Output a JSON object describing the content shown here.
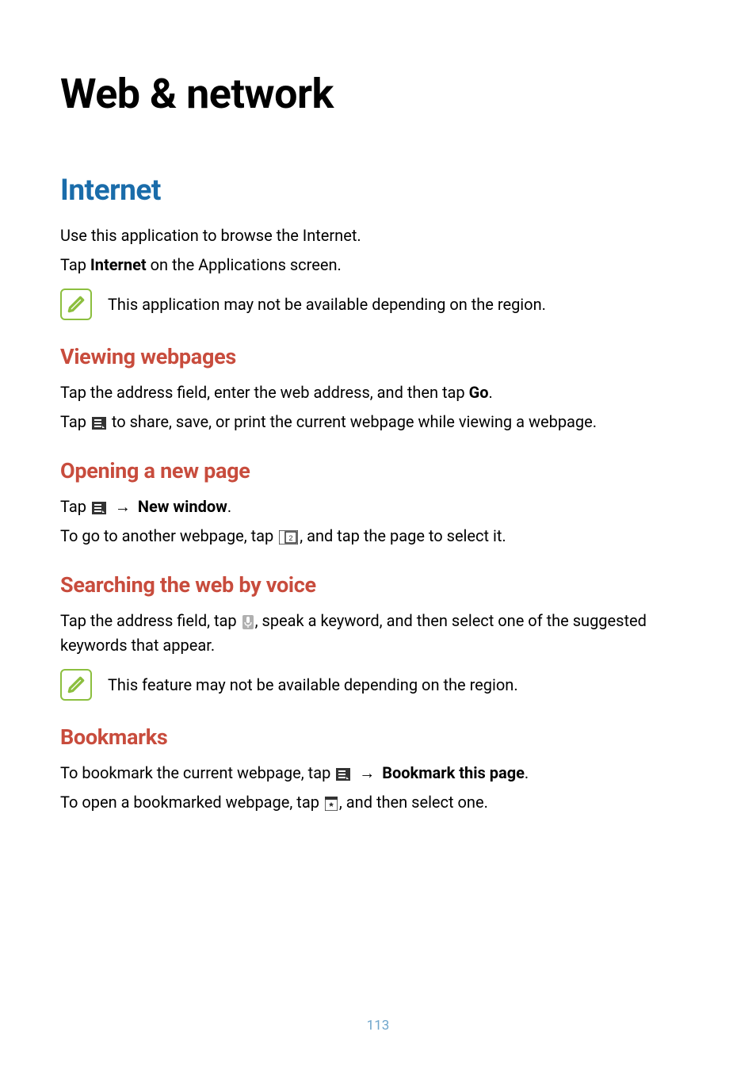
{
  "page_title": "Web & network",
  "page_number": "113",
  "internet": {
    "heading": "Internet",
    "intro_p1": "Use this application to browse the Internet.",
    "intro_p2_prefix": "Tap ",
    "intro_p2_bold": "Internet",
    "intro_p2_suffix": " on the Applications screen.",
    "note": "This application may not be available depending on the region."
  },
  "viewing": {
    "heading": "Viewing webpages",
    "p1_prefix": "Tap the address field, enter the web address, and then tap ",
    "p1_bold": "Go",
    "p1_suffix": ".",
    "p2_prefix": "Tap ",
    "p2_suffix": " to share, save, or print the current webpage while viewing a webpage."
  },
  "opening": {
    "heading": "Opening a new page",
    "p1_prefix": "Tap ",
    "p1_arrow": " → ",
    "p1_bold": "New window",
    "p1_suffix": ".",
    "p2_prefix": "To go to another webpage, tap ",
    "p2_suffix": ", and tap the page to select it."
  },
  "searching": {
    "heading": "Searching the web by voice",
    "p1_prefix": "Tap the address field, tap ",
    "p1_suffix": ", speak a keyword, and then select one of the suggested keywords that appear.",
    "note": "This feature may not be available depending on the region."
  },
  "bookmarks": {
    "heading": "Bookmarks",
    "p1_prefix": "To bookmark the current webpage, tap ",
    "p1_arrow": " → ",
    "p1_bold": "Bookmark this page",
    "p1_suffix": ".",
    "p2_prefix": "To open a bookmarked webpage, tap ",
    "p2_suffix": ", and then select one."
  }
}
